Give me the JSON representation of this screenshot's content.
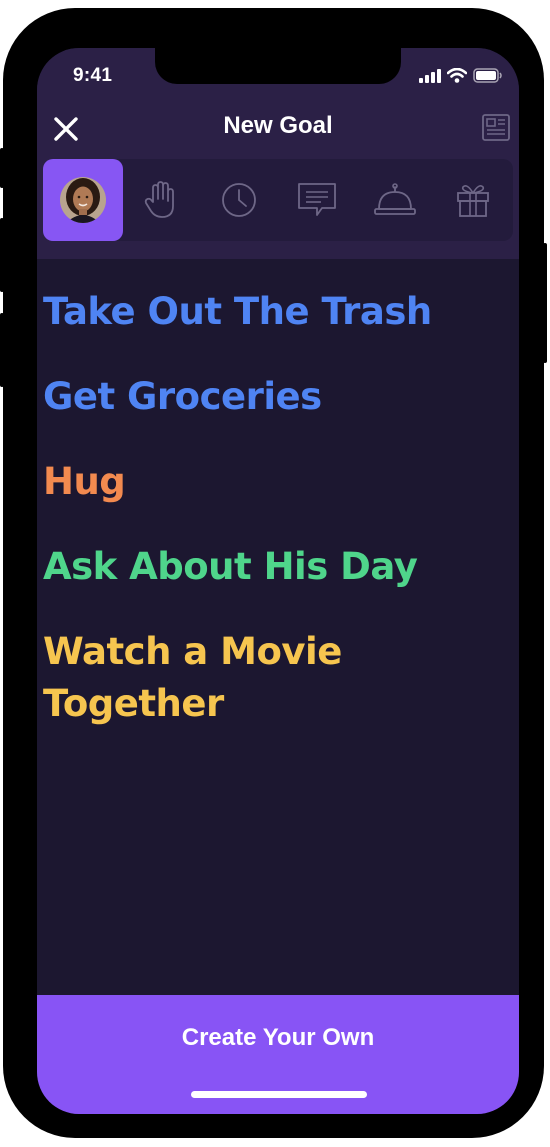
{
  "status_bar": {
    "time": "9:41",
    "icons": [
      "cellular-signal-icon",
      "wifi-icon",
      "battery-icon"
    ]
  },
  "nav": {
    "title": "New Goal",
    "left_icon": "close-icon",
    "right_icon": "document-icon"
  },
  "tabs": [
    {
      "icon": "avatar",
      "active": true
    },
    {
      "icon": "hand-icon",
      "active": false
    },
    {
      "icon": "clock-icon",
      "active": false
    },
    {
      "icon": "message-icon",
      "active": false
    },
    {
      "icon": "service-bell-icon",
      "active": false
    },
    {
      "icon": "gift-icon",
      "active": false
    }
  ],
  "goals": [
    {
      "label": "Take Out The Trash",
      "color": "#4f84f3"
    },
    {
      "label": "Get Groceries",
      "color": "#4f84f3"
    },
    {
      "label": "Hug",
      "color": "#f28a4f"
    },
    {
      "label": "Ask About His Day",
      "color": "#4fd58b"
    },
    {
      "label": "Watch a Movie Together",
      "color": "#f6c54f"
    }
  ],
  "cta": {
    "label": "Create Your Own",
    "color": "#8854f5"
  },
  "colors": {
    "background": "#1c1730",
    "header": "#2b2046",
    "accent": "#8756f3",
    "icon_muted": "#6e6787"
  }
}
